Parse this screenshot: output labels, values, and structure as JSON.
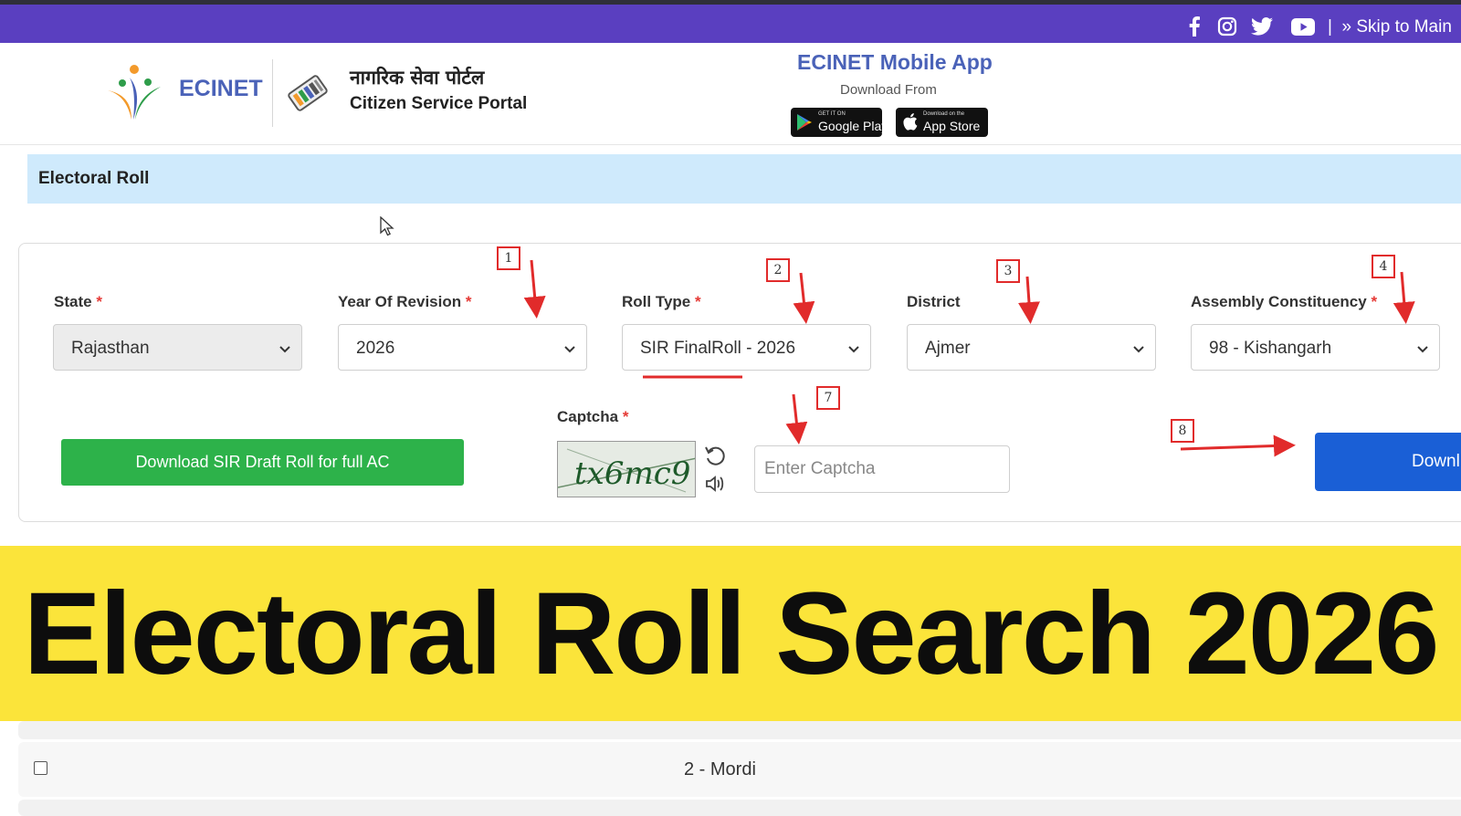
{
  "top_bar": {
    "social_icons": [
      "facebook-icon",
      "instagram-icon",
      "twitter-icon",
      "youtube-icon"
    ],
    "separator": "|",
    "skip_link": "» Skip to Main"
  },
  "header": {
    "brand": "ECINET",
    "portal_title_hindi": "नागरिक सेवा पोर्टल",
    "portal_title": "Citizen Service Portal",
    "app": {
      "title": "ECINET Mobile App",
      "subtitle": "Download From",
      "google_play_small": "GET IT ON",
      "google_play": "Google Play",
      "app_store_small": "Download on the",
      "app_store": "App Store"
    }
  },
  "section": {
    "title": "Electoral Roll"
  },
  "form": {
    "state": {
      "label": "State",
      "value": "Rajasthan",
      "required": "*"
    },
    "year": {
      "label": "Year Of Revision",
      "value": "2026",
      "required": "*"
    },
    "roll_type": {
      "label": "Roll Type",
      "value": "SIR FinalRoll - 2026",
      "required": "*"
    },
    "district": {
      "label": "District",
      "value": "Ajmer"
    },
    "assembly": {
      "label": "Assembly Constituency",
      "value": "98 - Kishangarh",
      "required": "*"
    },
    "captcha": {
      "label": "Captcha",
      "required": "*",
      "image_text": "tx6mc9",
      "placeholder": "Enter Captcha"
    },
    "draft_button": "Download SIR Draft Roll for full AC",
    "download_button": "Downl"
  },
  "markers": [
    "1",
    "2",
    "3",
    "4",
    "7",
    "8"
  ],
  "banner": {
    "text": "Electoral Roll Search 2026"
  },
  "list": {
    "items": [
      {
        "label": "2 - Mordi"
      }
    ]
  },
  "colors": {
    "top_bar": "#5a3fc0",
    "brand_blue": "#4a62b8",
    "section_bar": "#cfeafc",
    "green_button": "#2db24a",
    "blue_button": "#1a5fd6",
    "annotation_red": "#e12b2b",
    "banner_yellow": "#fbe43a"
  }
}
